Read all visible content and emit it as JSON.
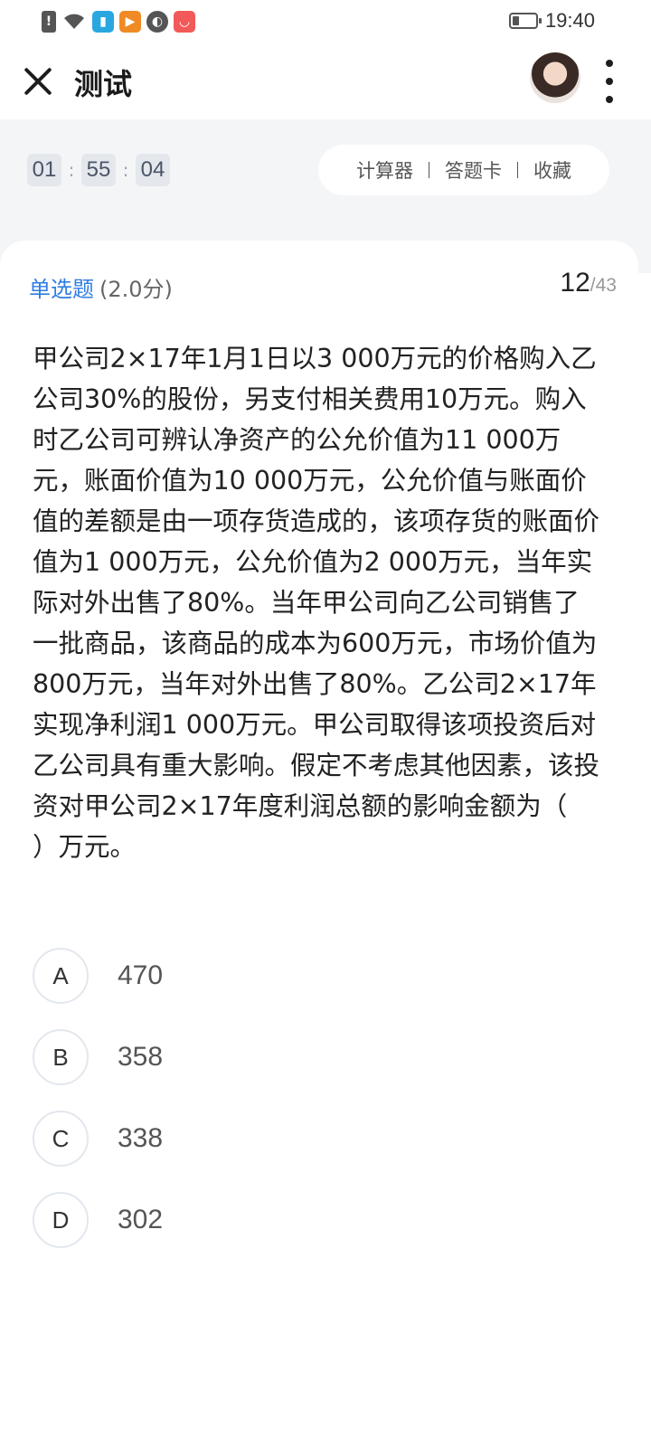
{
  "status_bar": {
    "time": "19:40",
    "battery_level": 0.3,
    "icons": [
      "alert-icon",
      "wifi-icon",
      "book-app-icon",
      "video-app-icon",
      "browser-app-icon",
      "shop-app-icon"
    ]
  },
  "header": {
    "title": "测试"
  },
  "timer": {
    "hours": "01",
    "minutes": "55",
    "seconds": "04",
    "separator": ":"
  },
  "tools": {
    "calculator": "计算器",
    "answer_card": "答题卡",
    "favorite": "收藏"
  },
  "question": {
    "type": "单选题",
    "score": "(2.0分)",
    "current": "12",
    "total": "/43",
    "stem": "甲公司2×17年1月1日以3 000万元的价格购入乙公司30%的股份，另支付相关费用10万元。购入时乙公司可辨认净资产的公允价值为11 000万元，账面价值为10 000万元，公允价值与账面价值的差额是由一项存货造成的，该项存货的账面价值为1 000万元，公允价值为2 000万元，当年实际对外出售了80%。当年甲公司向乙公司销售了一批商品，该商品的成本为600万元，市场价值为800万元，当年对外出售了80%。乙公司2×17年实现净利润1 000万元。甲公司取得该项投资后对乙公司具有重大影响。假定不考虑其他因素，该投资对甲公司2×17年度利润总额的影响金额为（　　）万元。",
    "options": [
      {
        "letter": "A",
        "text": "470"
      },
      {
        "letter": "B",
        "text": "358"
      },
      {
        "letter": "C",
        "text": "338"
      },
      {
        "letter": "D",
        "text": "302"
      }
    ]
  },
  "colors": {
    "accent": "#2f7de1",
    "page_bg": "#f4f5f7"
  }
}
